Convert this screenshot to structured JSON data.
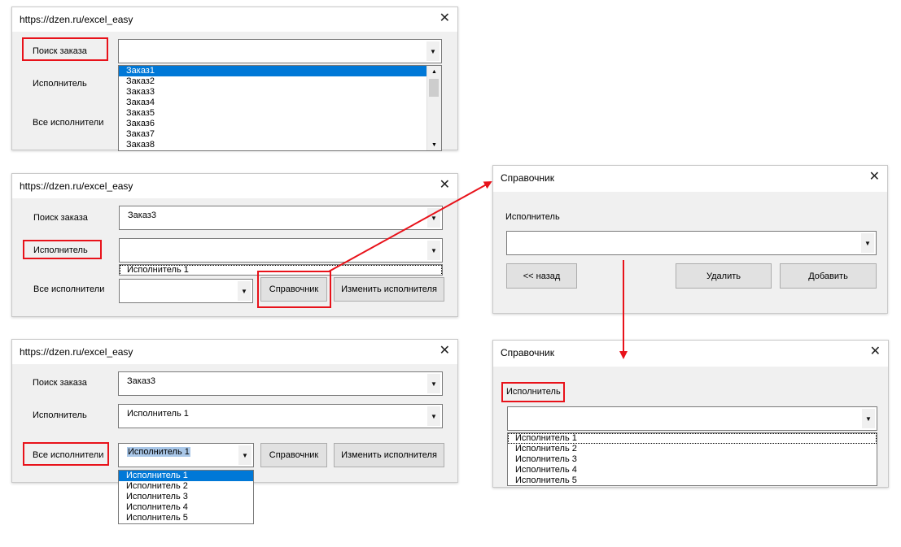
{
  "w1": {
    "title": "https://dzen.ru/excel_easy",
    "lbl_search": "Поиск заказа",
    "lbl_exec": "Исполнитель",
    "lbl_all": "Все исполнители",
    "orders": [
      "Заказ1",
      "Заказ2",
      "Заказ3",
      "Заказ4",
      "Заказ5",
      "Заказ6",
      "Заказ7",
      "Заказ8"
    ]
  },
  "w2": {
    "title": "https://dzen.ru/excel_easy",
    "lbl_search": "Поиск заказа",
    "lbl_exec": "Исполнитель",
    "lbl_all": "Все исполнители",
    "search_value": "Заказ3",
    "exec_list_item": "Исполнитель 1",
    "btn_ref": "Справочник",
    "btn_change": "Изменить исполнителя"
  },
  "w3": {
    "title": "https://dzen.ru/excel_easy",
    "lbl_search": "Поиск заказа",
    "lbl_exec": "Исполнитель",
    "lbl_all": "Все исполнители",
    "search_value": "Заказ3",
    "exec_value": "Исполнитель 1",
    "all_value": "Исполнитель 1",
    "btn_ref": "Справочник",
    "btn_change": "Изменить исполнителя",
    "executors": [
      "Исполнитель 1",
      "Исполнитель 2",
      "Исполнитель 3",
      "Исполнитель 4",
      "Исполнитель 5"
    ]
  },
  "w4": {
    "title": "Справочник",
    "lbl_exec": "Исполнитель",
    "btn_back": "<< назад",
    "btn_delete": "Удалить",
    "btn_add": "Добавить"
  },
  "w5": {
    "title": "Справочник",
    "lbl_exec": "Исполнитель",
    "executors": [
      "Исполнитель 1",
      "Исполнитель 2",
      "Исполнитель 3",
      "Исполнитель 4",
      "Исполнитель 5"
    ]
  },
  "icons": {
    "close": "close-icon",
    "dropdown": "chevron-down-icon"
  },
  "colors": {
    "highlight": "#e8121a",
    "selection": "#0078d7"
  }
}
